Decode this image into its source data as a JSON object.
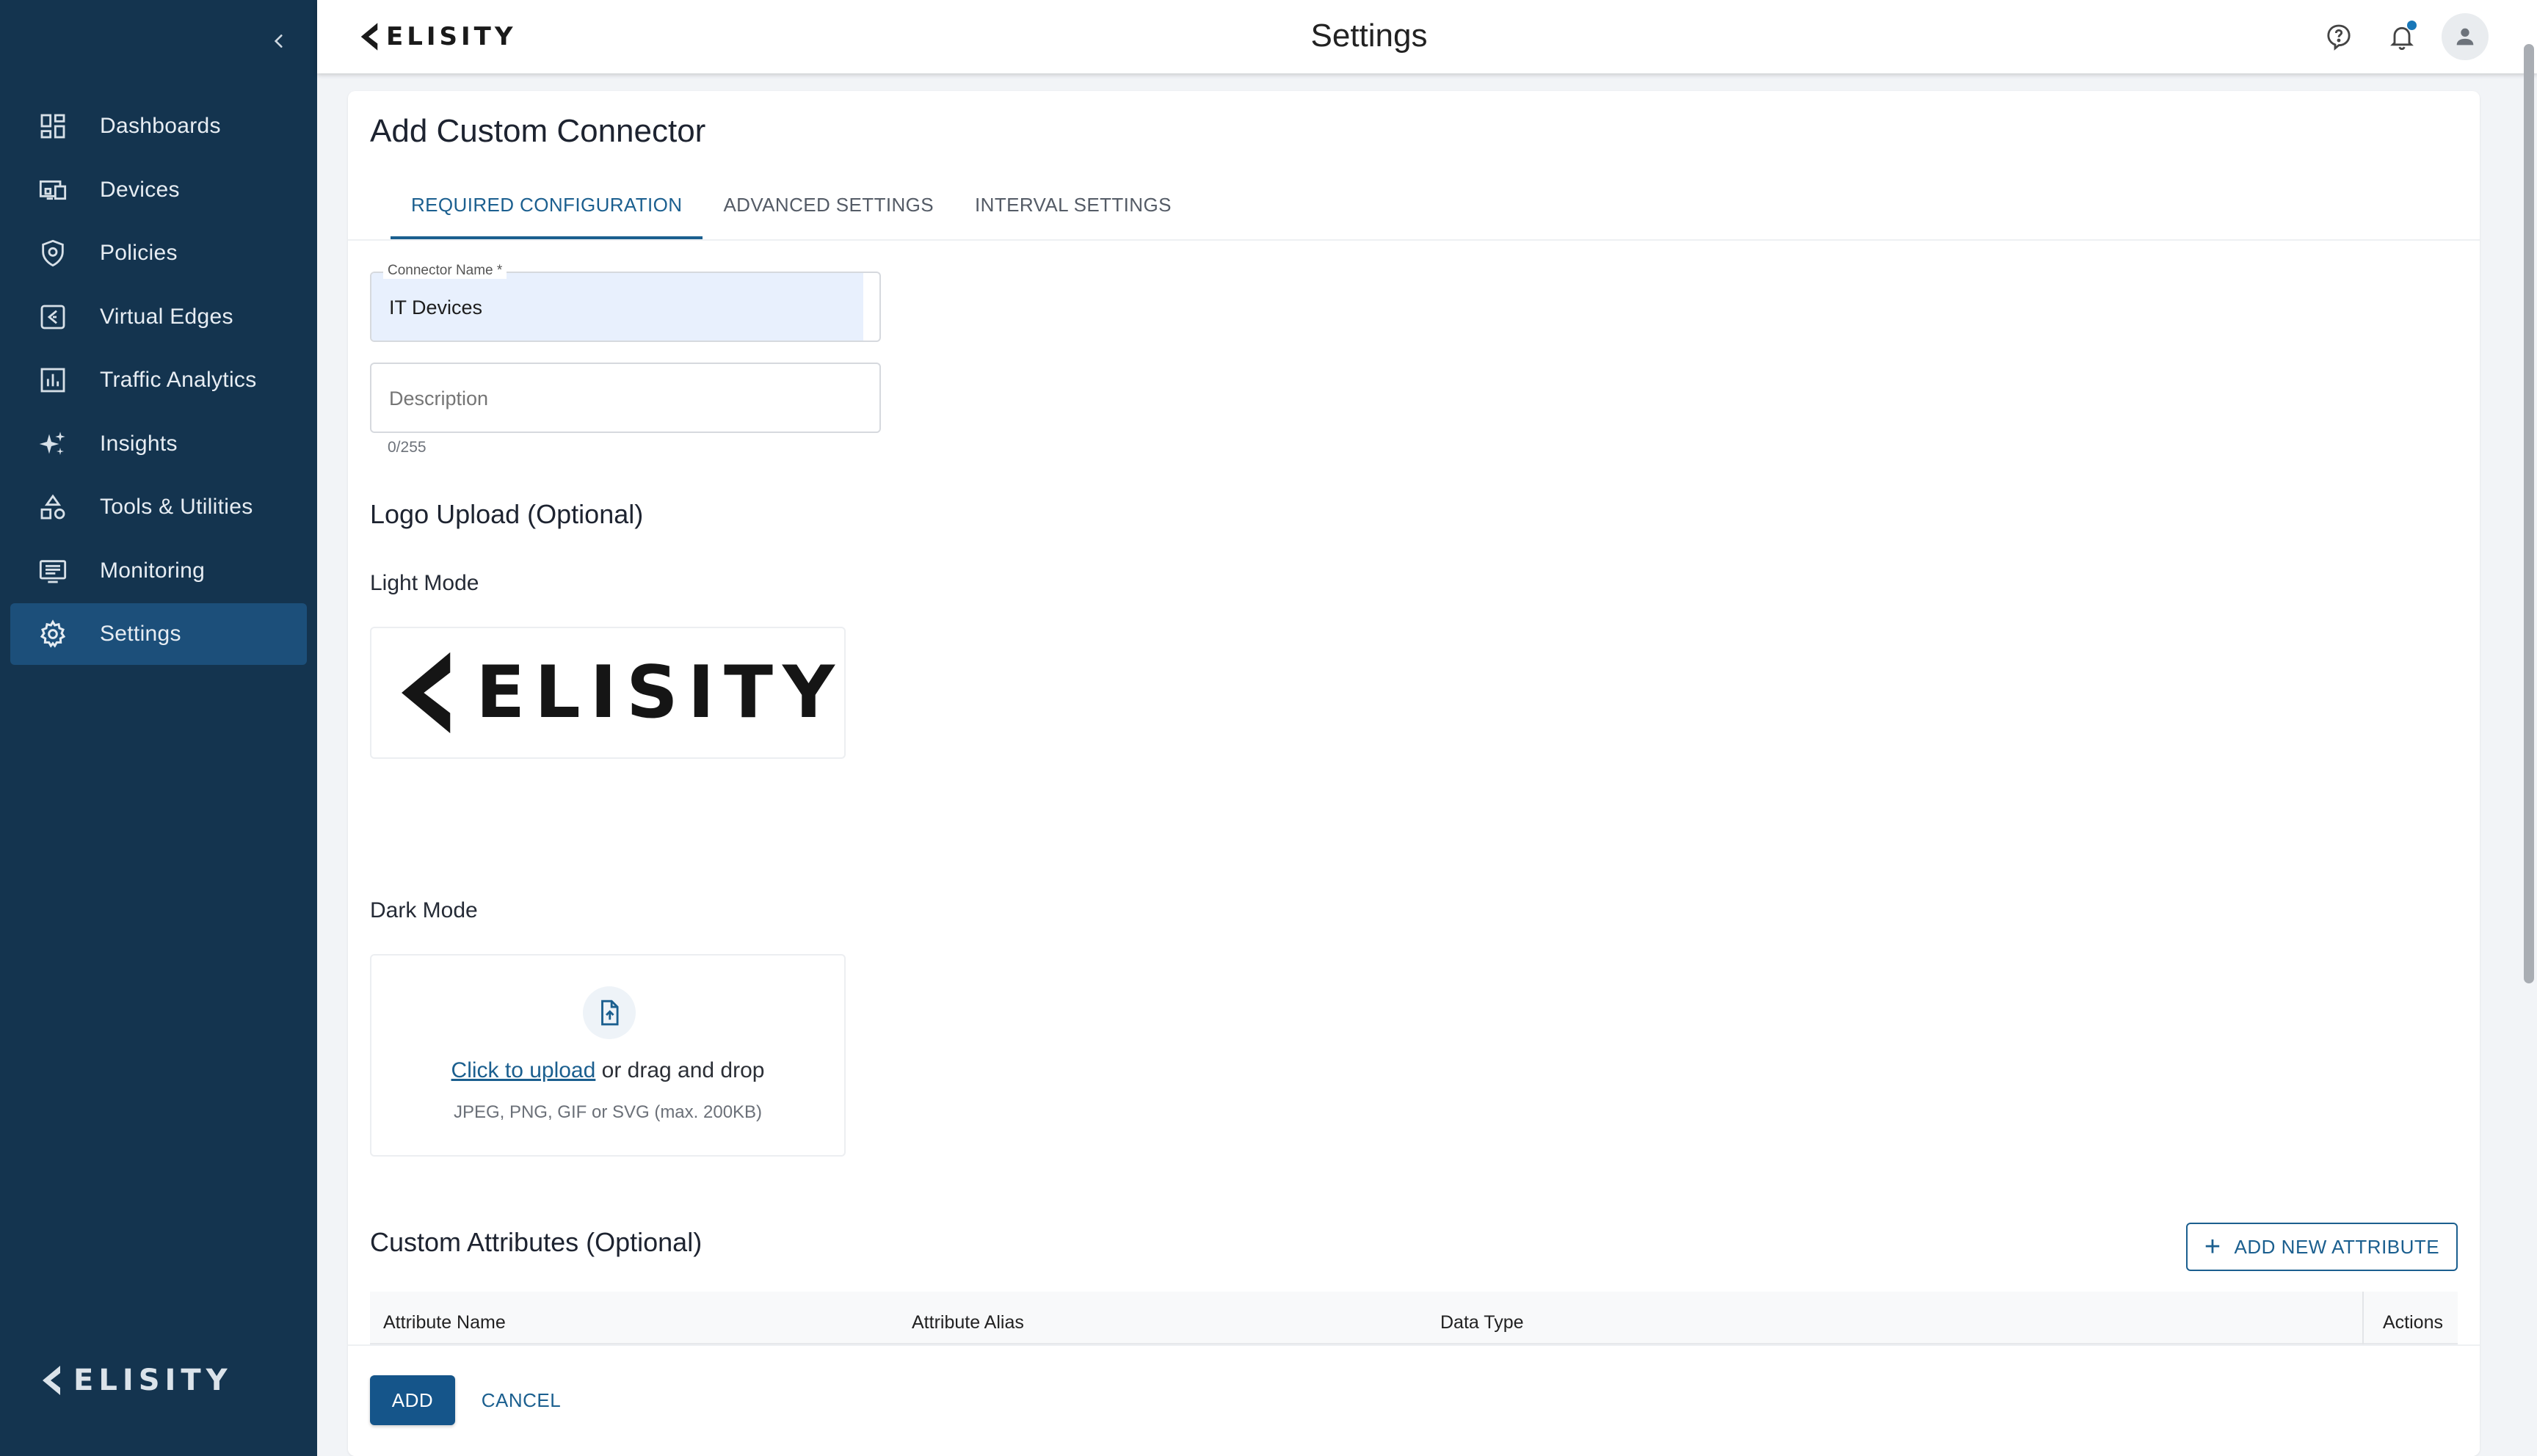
{
  "sidebar": {
    "items": [
      {
        "label": "Dashboards",
        "icon": "dashboard-icon"
      },
      {
        "label": "Devices",
        "icon": "devices-icon"
      },
      {
        "label": "Policies",
        "icon": "policy-shield-icon"
      },
      {
        "label": "Virtual Edges",
        "icon": "virtual-edge-icon"
      },
      {
        "label": "Traffic Analytics",
        "icon": "bar-chart-icon"
      },
      {
        "label": "Insights",
        "icon": "sparkle-icon"
      },
      {
        "label": "Tools & Utilities",
        "icon": "tools-shapes-icon"
      },
      {
        "label": "Monitoring",
        "icon": "monitor-list-icon"
      },
      {
        "label": "Settings",
        "icon": "gear-icon",
        "active": true
      }
    ],
    "brand": "ELISITY"
  },
  "header": {
    "brand": "ELISITY",
    "title": "Settings"
  },
  "page": {
    "title": "Add Custom Connector",
    "tabs": [
      {
        "label": "REQUIRED CONFIGURATION",
        "active": true
      },
      {
        "label": "ADVANCED SETTINGS"
      },
      {
        "label": "INTERVAL SETTINGS"
      }
    ],
    "connector_name": {
      "label": "Connector Name *",
      "value": "IT Devices"
    },
    "description": {
      "placeholder": "Description",
      "counter": "0/255"
    },
    "logo_section": {
      "title": "Logo Upload (Optional)",
      "light_label": "Light Mode",
      "light_logo_text": "ELISITY",
      "dark_label": "Dark Mode",
      "upload_link": "Click to upload",
      "upload_rest": " or drag and drop",
      "upload_hint": "JPEG, PNG, GIF or SVG (max. 200KB)"
    },
    "attributes": {
      "title": "Custom Attributes (Optional)",
      "add_button": "ADD NEW ATTRIBUTE",
      "columns": [
        "Attribute Name",
        "Attribute Alias",
        "Data Type",
        "Actions"
      ]
    },
    "actions": {
      "add": "ADD",
      "cancel": "CANCEL"
    }
  },
  "colors": {
    "sidebar_bg": "#14344f",
    "sidebar_active": "#1c4f7a",
    "accent": "#1b5f8f",
    "primary_button": "#15558a",
    "name_field_fill": "#e8f0fd"
  }
}
